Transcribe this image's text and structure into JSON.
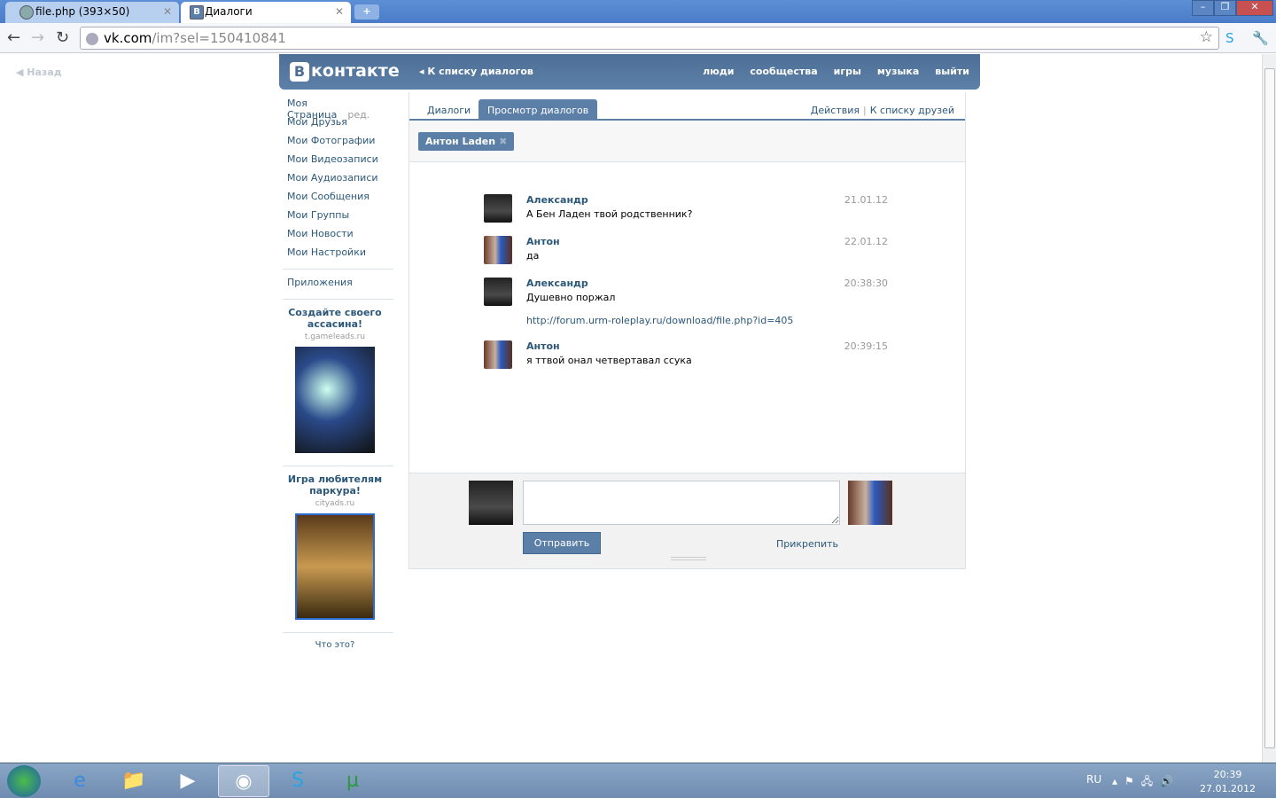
{
  "browser": {
    "tabs": [
      {
        "title": "file.php (393×50)"
      },
      {
        "title": "Диалоги",
        "favicon": "В"
      }
    ],
    "url_host": "vk.com",
    "url_path": "/im?sel=150410841"
  },
  "page": {
    "back": "Назад"
  },
  "header": {
    "logo_b": "В",
    "logo": "контакте",
    "back_to_list": "К списку диалогов",
    "nav": [
      "люди",
      "сообщества",
      "игры",
      "музыка",
      "выйти"
    ]
  },
  "sidebar": {
    "items": [
      {
        "label": "Моя Страница",
        "extra": "ред."
      },
      {
        "label": "Мои Друзья"
      },
      {
        "label": "Мои Фотографии"
      },
      {
        "label": "Мои Видеозаписи"
      },
      {
        "label": "Мои Аудиозаписи"
      },
      {
        "label": "Мои Сообщения"
      },
      {
        "label": "Мои Группы"
      },
      {
        "label": "Мои Новости"
      },
      {
        "label": "Мои Настройки"
      }
    ],
    "apps": "Приложения",
    "ads": [
      {
        "title": "Создайте своего ассасина!",
        "domain": "t.gameleads.ru"
      },
      {
        "title": "Игра любителям паркура!",
        "domain": "cityads.ru"
      }
    ],
    "what": "Что это?"
  },
  "main": {
    "tabs": [
      "Диалоги",
      "Просмотр диалогов"
    ],
    "actions": "Действия",
    "sep": "|",
    "friends": "К списку друзей",
    "peer": "Антон Laden",
    "messages": [
      {
        "author": "Александр",
        "text": "А Бен Ладен твой родственник?",
        "time": "21.01.12"
      },
      {
        "author": "Антон",
        "text": "да",
        "time": "22.01.12"
      },
      {
        "author": "Александр",
        "text": "Душевно поржал",
        "time": "20:38:30",
        "link": "http://forum.urm-roleplay.ru/download/file.php?id=405"
      },
      {
        "author": "Антон",
        "text": "я ттвой онал четвертавал ссука",
        "time": "20:39:15"
      }
    ],
    "send": "Отправить",
    "attach": "Прикрепить",
    "input_value": ""
  },
  "taskbar": {
    "lang": "RU",
    "time": "20:39",
    "date": "27.01.2012"
  }
}
